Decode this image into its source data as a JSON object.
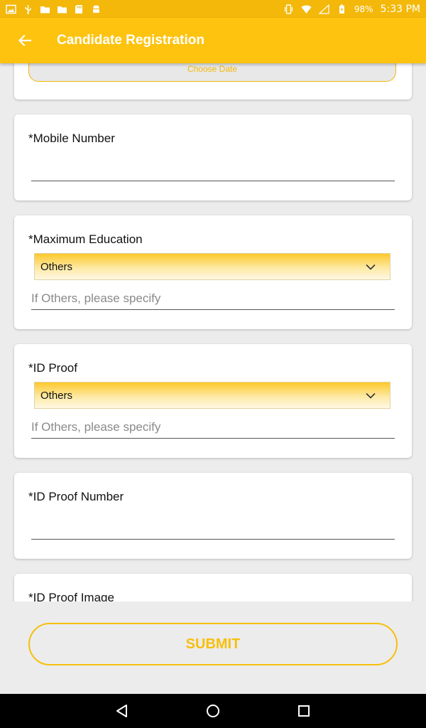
{
  "status_bar": {
    "left_icons": [
      "image-icon",
      "usb-icon",
      "folder-icon",
      "folder-icon",
      "sd-card-icon",
      "android-icon"
    ],
    "right_icons": [
      "vibrate-icon",
      "wifi-icon",
      "signal-icon",
      "battery-charging-icon"
    ],
    "battery": "98%",
    "time": "5:33 PM"
  },
  "app_bar": {
    "title": "Candidate Registration",
    "back_icon": "arrow-back-icon"
  },
  "date_field": {
    "label": "Choose Date"
  },
  "fields": {
    "mobile": {
      "label": "*Mobile Number",
      "value": ""
    },
    "education": {
      "label": "*Maximum Education",
      "selected": "Others",
      "specify_placeholder": "If Others, please specify"
    },
    "id_proof": {
      "label": "*ID Proof",
      "selected": "Others",
      "specify_placeholder": "If Others, please specify"
    },
    "id_proof_number": {
      "label": "*ID Proof Number",
      "value": ""
    },
    "id_proof_image": {
      "label": "*ID Proof Image"
    }
  },
  "submit": {
    "label": "SUBMIT"
  },
  "nav_bar": {
    "icons": [
      "back-triangle-icon",
      "home-circle-icon",
      "recents-square-icon"
    ]
  },
  "colors": {
    "status_bar": "#f3b80a",
    "app_bar": "#fdc30f",
    "accent": "#f7bf0e",
    "background": "#ececec"
  }
}
